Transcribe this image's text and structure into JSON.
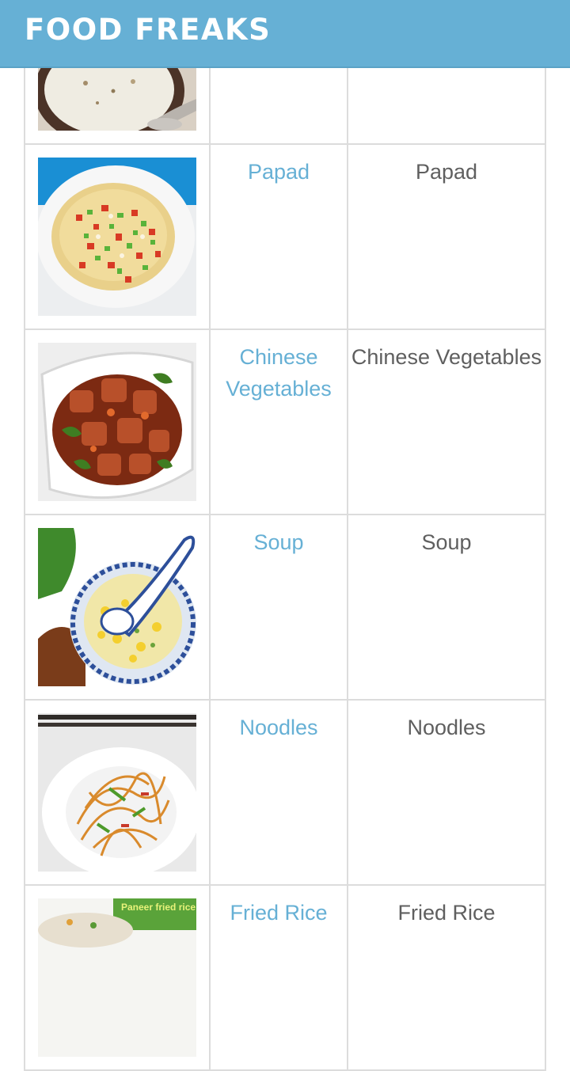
{
  "app": {
    "title": "FOOD FREAKS",
    "accent": "#66b0d5"
  },
  "rows": [
    {
      "image": "raita-bowl-photo",
      "link": "",
      "name": ""
    },
    {
      "image": "masala-papad-photo",
      "link": "Papad",
      "name": "Papad"
    },
    {
      "image": "chinese-vegetables-photo",
      "link": "Chinese Vegetables",
      "name": "Chinese Vegetables"
    },
    {
      "image": "corn-soup-photo",
      "link": "Soup",
      "name": "Soup"
    },
    {
      "image": "noodles-photo",
      "link": "Noodles",
      "name": "Noodles"
    },
    {
      "image": "fried-rice-photo",
      "image_caption": "Paneer fried rice",
      "link": "Fried Rice",
      "name": "Fried Rice"
    }
  ]
}
